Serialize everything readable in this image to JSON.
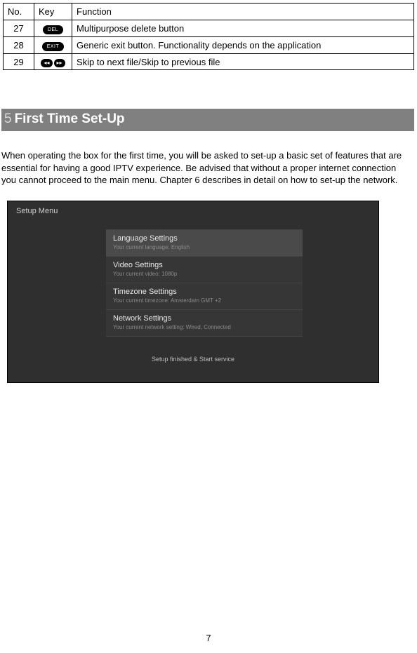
{
  "table": {
    "headers": {
      "no": "No.",
      "key": "Key",
      "fn": "Function"
    },
    "rows": [
      {
        "no": "27",
        "key_label": "DEL",
        "fn": "Multipurpose delete button"
      },
      {
        "no": "28",
        "key_label": "EXIT",
        "fn": "Generic exit button. Functionality depends on the application"
      },
      {
        "no": "29",
        "key_label_a": "◂◂",
        "key_label_b": "▸▸",
        "fn": "Skip to next file/Skip to previous file"
      }
    ]
  },
  "section": {
    "num": "5",
    "title": "First Time Set-Up"
  },
  "body": "When operating the box for the first time, you will be asked to set-up a basic set of features that are essential for having a good IPTV experience. Be advised that without a proper internet connection you cannot proceed to the main menu. Chapter 6 describes in detail on how to set-up the network.",
  "setup": {
    "title": "Setup Menu",
    "items": [
      {
        "t": "Language Settings",
        "s": "Your current language: English"
      },
      {
        "t": "Video Settings",
        "s": "Your current video: 1080p"
      },
      {
        "t": "Timezone Settings",
        "s": "Your current timezone: Amsterdam GMT +2"
      },
      {
        "t": "Network Settings",
        "s": "Your current network setting: Wired, Connected"
      }
    ],
    "finish": "Setup finished & Start service"
  },
  "page_number": "7"
}
